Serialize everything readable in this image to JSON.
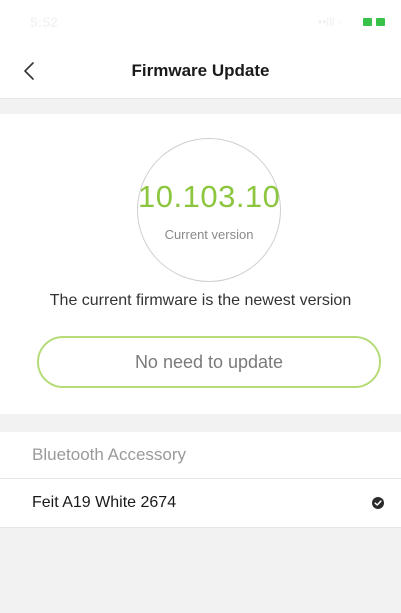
{
  "status_bar": {
    "time": "5:52",
    "signal": "••lll ◦"
  },
  "nav": {
    "title": "Firmware Update",
    "back_icon": "chevron-left-icon"
  },
  "firmware": {
    "version": "10.103.10",
    "version_caption": "Current version",
    "status_message": "The current firmware is the newest version",
    "action_label": "No need to update",
    "accent_color": "#8cc63f",
    "button_border_color": "#b6dc79"
  },
  "accessories": {
    "header": "Bluetooth Accessory",
    "items": [
      {
        "name": "Feit A19 White 2674",
        "selected": true,
        "icon": "check-circle-icon"
      }
    ]
  }
}
